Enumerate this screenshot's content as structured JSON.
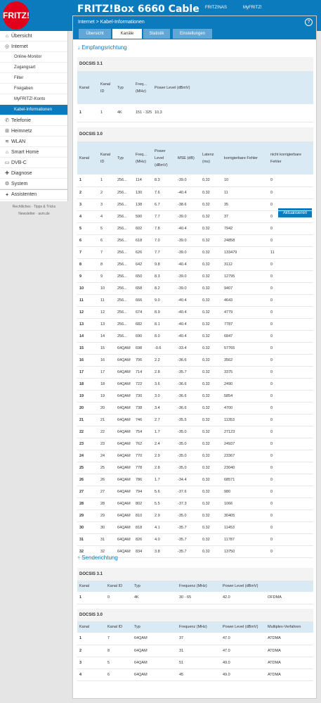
{
  "header": {
    "logo": "FRITZ!",
    "title": "FRITZ!Box 6660 Cable",
    "links": [
      "FRITZ!NAS",
      "MyFRITZ!"
    ]
  },
  "sidebar": {
    "items": [
      {
        "label": "Übersicht",
        "icon": "home-icon",
        "glyph": "⌂"
      },
      {
        "label": "Internet",
        "icon": "globe-icon",
        "glyph": "◎"
      },
      {
        "label": "Online-Monitor",
        "sub": true
      },
      {
        "label": "Zugangsart",
        "sub": true
      },
      {
        "label": "Filter",
        "sub": true
      },
      {
        "label": "Freigaben",
        "sub": true
      },
      {
        "label": "MyFRITZ!-Konto",
        "sub": true
      },
      {
        "label": "Kabel-Informationen",
        "sub": true,
        "active": true
      },
      {
        "label": "Telefonie",
        "icon": "phone-icon",
        "glyph": "✆"
      },
      {
        "label": "Heimnetz",
        "icon": "network-icon",
        "glyph": "⊞"
      },
      {
        "label": "WLAN",
        "icon": "wifi-icon",
        "glyph": "≋"
      },
      {
        "label": "Smart Home",
        "icon": "smarthome-icon",
        "glyph": "⌂"
      },
      {
        "label": "DVB-C",
        "icon": "tv-icon",
        "glyph": "▭"
      },
      {
        "label": "Diagnose",
        "icon": "diagnose-icon",
        "glyph": "✚"
      },
      {
        "label": "System",
        "icon": "system-icon",
        "glyph": "⚙"
      },
      {
        "label": "Assistenten",
        "icon": "wizard-icon",
        "glyph": "✦"
      }
    ],
    "footer": [
      "Rechtliches · Tipps & Tricks",
      "Newsletter · avm.de"
    ]
  },
  "breadcrumb": "Internet > Kabel-Informationen",
  "tabs": [
    "Übersicht",
    "Kanäle",
    "Statistik",
    "Einstellungen"
  ],
  "down_title": "↓ Empfangsrichtung",
  "up_title": "↑ Senderichtung",
  "refresh": "Aktualisieren",
  "d31": {
    "group": "DOCSIS 3.1",
    "headers": [
      "Kanal",
      "Kanal ID",
      "Typ",
      "Freq... (MHz)",
      "Power Level (dBmV)"
    ],
    "rows": [
      [
        "1",
        "1",
        "4K",
        "151 - 325",
        "10,3"
      ]
    ]
  },
  "d30": {
    "group": "DOCSIS 3.0",
    "headers": [
      "Kanal",
      "Kanal ID",
      "Typ",
      "Freq... (MHz)",
      "Power Level (dBmV)",
      "MSE (dB)",
      "Latenz (ms)",
      "korrigierbare Fehler",
      "nicht korrigierbare Fehler"
    ],
    "rows": [
      [
        "1",
        "1",
        "256...",
        "114",
        "8.3",
        "-39.0",
        "0.32",
        "10",
        "0"
      ],
      [
        "2",
        "2",
        "256...",
        "130",
        "7.6",
        "-40.4",
        "0.32",
        "11",
        "0"
      ],
      [
        "3",
        "3",
        "256...",
        "138",
        "6.7",
        "-38.6",
        "0.32",
        "35",
        "0"
      ],
      [
        "4",
        "4",
        "256...",
        "590",
        "7.7",
        "-39.0",
        "0.32",
        "37",
        "0"
      ],
      [
        "5",
        "5",
        "256...",
        "602",
        "7.8",
        "-40.4",
        "0.32",
        "7942",
        "0"
      ],
      [
        "6",
        "6",
        "256...",
        "618",
        "7.0",
        "-39.0",
        "0.32",
        "24858",
        "0"
      ],
      [
        "7",
        "7",
        "256...",
        "626",
        "7.7",
        "-39.0",
        "0.32",
        "133479",
        "11"
      ],
      [
        "8",
        "8",
        "256...",
        "642",
        "9.8",
        "-40.4",
        "0.32",
        "3112",
        "0"
      ],
      [
        "9",
        "9",
        "256...",
        "650",
        "8.3",
        "-39.0",
        "0.32",
        "12795",
        "0"
      ],
      [
        "10",
        "10",
        "256...",
        "658",
        "8.2",
        "-39.0",
        "0.32",
        "9407",
        "0"
      ],
      [
        "11",
        "11",
        "256...",
        "666",
        "9.0",
        "-40.4",
        "0.32",
        "4643",
        "0"
      ],
      [
        "12",
        "12",
        "256...",
        "674",
        "8.9",
        "-40.4",
        "0.32",
        "4779",
        "0"
      ],
      [
        "13",
        "13",
        "256...",
        "682",
        "8.1",
        "-40.4",
        "0.32",
        "7787",
        "0"
      ],
      [
        "14",
        "14",
        "256...",
        "690",
        "8.0",
        "-40.4",
        "0.32",
        "6847",
        "0"
      ],
      [
        "15",
        "15",
        "64QAM",
        "698",
        "-0.6",
        "-33.4",
        "0.32",
        "57765",
        "0"
      ],
      [
        "16",
        "16",
        "64QAM",
        "706",
        "2.2",
        "-36.6",
        "0.32",
        "3562",
        "0"
      ],
      [
        "17",
        "17",
        "64QAM",
        "714",
        "2.8",
        "-35.7",
        "0.32",
        "3375",
        "0"
      ],
      [
        "18",
        "18",
        "64QAM",
        "722",
        "3.6",
        "-36.6",
        "0.32",
        "2490",
        "0"
      ],
      [
        "19",
        "19",
        "64QAM",
        "730",
        "3.0",
        "-36.6",
        "0.32",
        "5854",
        "0"
      ],
      [
        "20",
        "20",
        "64QAM",
        "738",
        "3.4",
        "-36.6",
        "0.32",
        "4700",
        "0"
      ],
      [
        "21",
        "21",
        "64QAM",
        "746",
        "2.7",
        "-35.5",
        "0.32",
        "11353",
        "0"
      ],
      [
        "22",
        "22",
        "64QAM",
        "754",
        "1.7",
        "-35.0",
        "0.32",
        "27123",
        "0"
      ],
      [
        "23",
        "23",
        "64QAM",
        "762",
        "2.4",
        "-35.0",
        "0.32",
        "24937",
        "0"
      ],
      [
        "24",
        "24",
        "64QAM",
        "770",
        "2.9",
        "-35.0",
        "0.32",
        "23367",
        "0"
      ],
      [
        "25",
        "25",
        "64QAM",
        "778",
        "2.8",
        "-35.0",
        "0.32",
        "23040",
        "0"
      ],
      [
        "26",
        "26",
        "64QAM",
        "786",
        "1.7",
        "-34.4",
        "0.32",
        "68571",
        "0"
      ],
      [
        "27",
        "27",
        "64QAM",
        "794",
        "5.6",
        "-37.6",
        "0.32",
        "980",
        "0"
      ],
      [
        "28",
        "28",
        "64QAM",
        "802",
        "5.5",
        "-37.3",
        "0.32",
        "1066",
        "0"
      ],
      [
        "29",
        "29",
        "64QAM",
        "810",
        "2.9",
        "-35.0",
        "0.32",
        "30405",
        "0"
      ],
      [
        "30",
        "30",
        "64QAM",
        "818",
        "4.1",
        "-35.7",
        "0.32",
        "11453",
        "0"
      ],
      [
        "31",
        "31",
        "64QAM",
        "826",
        "4.0",
        "-35.7",
        "0.32",
        "11787",
        "0"
      ],
      [
        "32",
        "32",
        "64QAM",
        "834",
        "3.8",
        "-35.7",
        "0.32",
        "13750",
        "0"
      ]
    ]
  },
  "u31": {
    "group": "DOCSIS 3.1",
    "headers": [
      "Kanal",
      "Kanal ID",
      "Typ",
      "Frequenz (MHz)",
      "Power Level (dBmV)",
      ""
    ],
    "rows": [
      [
        "1",
        "0",
        "4K",
        "30 - 65",
        "42.0",
        "OFDMA"
      ]
    ]
  },
  "u30": {
    "group": "DOCSIS 3.0",
    "headers": [
      "Kanal",
      "Kanal ID",
      "Typ",
      "Frequenz (MHz)",
      "Power Level (dBmV)",
      "Multiplex-Verfahren"
    ],
    "rows": [
      [
        "1",
        "7",
        "64QAM",
        "37",
        "47.0",
        "ATDMA"
      ],
      [
        "2",
        "8",
        "64QAM",
        "31",
        "47.0",
        "ATDMA"
      ],
      [
        "3",
        "5",
        "64QAM",
        "51",
        "49.0",
        "ATDMA"
      ],
      [
        "4",
        "6",
        "64QAM",
        "45",
        "49.0",
        "ATDMA"
      ]
    ]
  }
}
